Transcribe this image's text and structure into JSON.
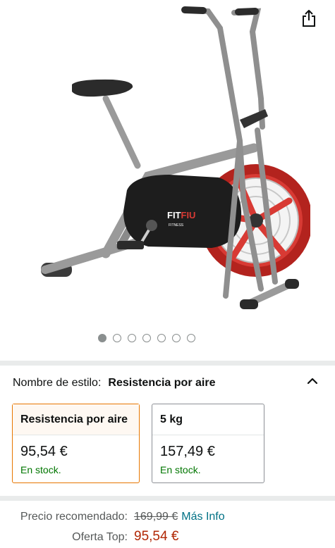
{
  "gallery": {
    "image_alt": "Bicicleta de aire FITFIU Fitness",
    "brand_logo": "FITFIU",
    "brand_sub": "FITNESS",
    "dot_count": 7,
    "active_dot": 0
  },
  "style_selector": {
    "label": "Nombre de estilo:",
    "selected": "Resistencia por aire",
    "options": [
      {
        "title": "Resistencia por aire",
        "price": "95,54 €",
        "stock": "En stock."
      },
      {
        "title": "5 kg",
        "price": "157,49 €",
        "stock": "En stock."
      }
    ]
  },
  "pricing": {
    "recommended_label": "Precio recomendado:",
    "recommended_price": "169,99 €",
    "more_info": "Más Info",
    "offer_label": "Oferta Top:",
    "offer_price": "95,54 €"
  },
  "colors": {
    "accent_border": "#e77600",
    "stock_green": "#007600",
    "price_red": "#b12704",
    "link_teal": "#007185"
  },
  "icons": [
    "share-icon",
    "chevron-up-icon"
  ]
}
